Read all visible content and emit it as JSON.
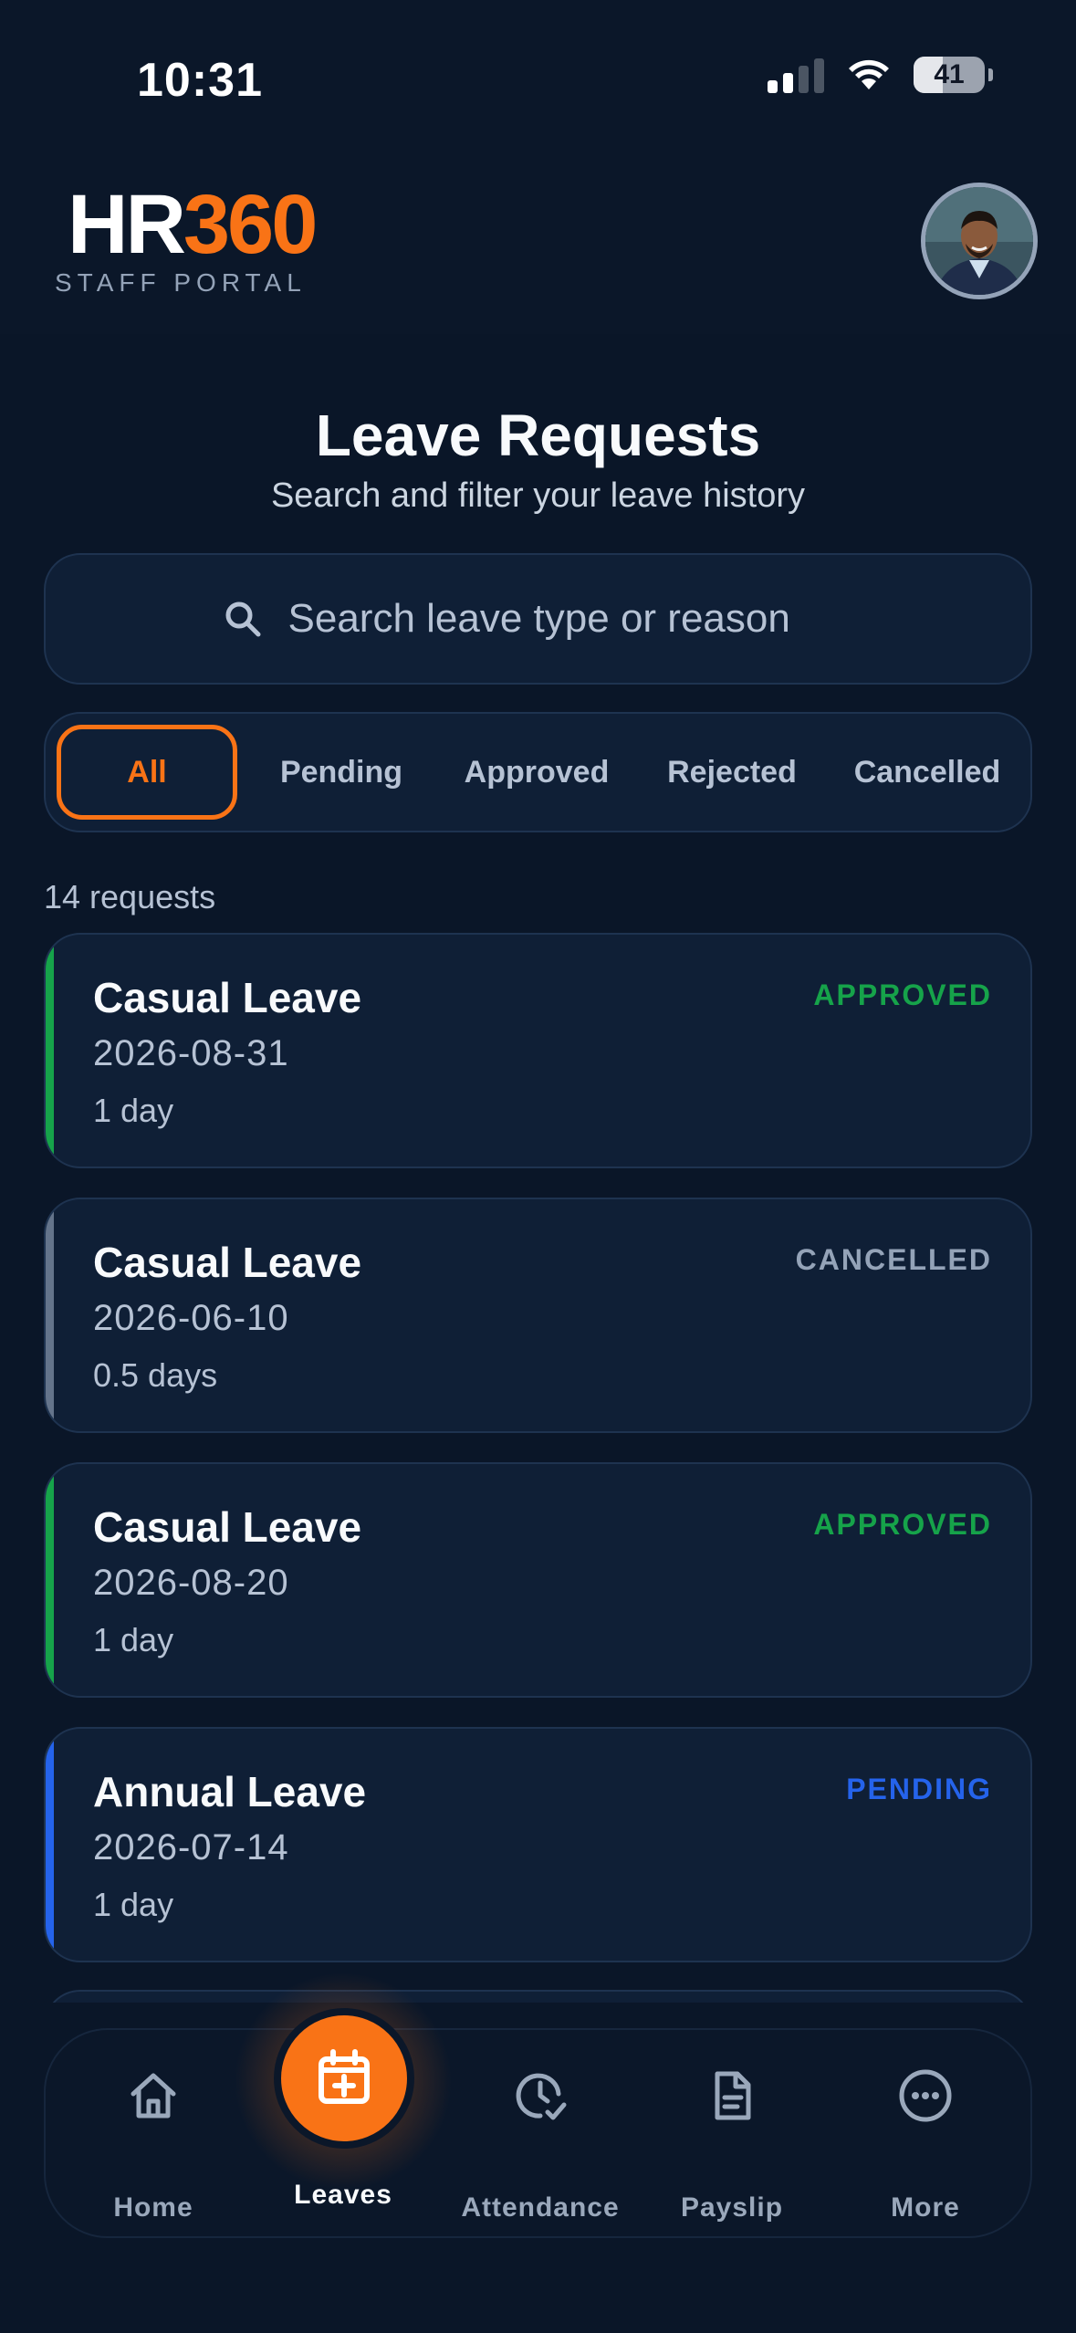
{
  "status_bar": {
    "time": "10:31",
    "battery": "41"
  },
  "header": {
    "logo_main": "HR",
    "logo_accent": "360",
    "logo_subtitle": "STAFF PORTAL"
  },
  "page": {
    "title": "Leave Requests",
    "subtitle": "Search and filter your leave history"
  },
  "search": {
    "placeholder": "Search leave type or reason",
    "value": ""
  },
  "filters": {
    "items": [
      "All",
      "Pending",
      "Approved",
      "Rejected",
      "Cancelled"
    ],
    "selected": "All"
  },
  "request_count": "14 requests",
  "requests": [
    {
      "type": "Casual Leave",
      "date": "2026-08-31",
      "duration": "1 day",
      "status": "APPROVED"
    },
    {
      "type": "Casual Leave",
      "date": "2026-06-10",
      "duration": "0.5 days",
      "status": "CANCELLED"
    },
    {
      "type": "Casual Leave",
      "date": "2026-08-20",
      "duration": "1 day",
      "status": "APPROVED"
    },
    {
      "type": "Annual Leave",
      "date": "2026-07-14",
      "duration": "1 day",
      "status": "PENDING"
    }
  ],
  "status_colors": {
    "APPROVED": "#16a34a",
    "CANCELLED": "#94a3b8",
    "PENDING": "#2563eb"
  },
  "accent_color": "#f97316",
  "nav": {
    "home": "Home",
    "leaves": "Leaves",
    "attendance": "Attendance",
    "payslip": "Payslip",
    "more": "More",
    "active": "leaves"
  }
}
